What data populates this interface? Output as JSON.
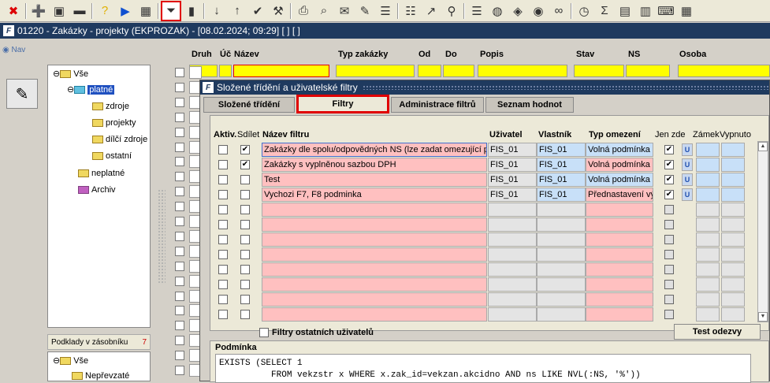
{
  "toolbar": {
    "icons": [
      "close-icon",
      "add-icon",
      "save-icon",
      "minus-icon",
      "help-icon",
      "play-icon",
      "calendar-icon",
      "filter-icon",
      "signal-icon",
      "sort-asc-icon",
      "sort-desc-icon",
      "check-icon",
      "wrench-icon",
      "print-icon",
      "print-preview-icon",
      "mail-icon",
      "edit-icon",
      "list-icon",
      "checklist-icon",
      "open-external-icon",
      "attach-icon",
      "sliders-icon",
      "globe-icon",
      "compass-icon",
      "eye-icon",
      "glasses-icon",
      "clock-icon",
      "sigma-icon",
      "excel-icon",
      "doc-icon",
      "keyboard-icon",
      "grid-icon"
    ]
  },
  "window": {
    "title": "01220 - Zakázky - projekty (EKPROZAK) - [08.02.2024; 09:29]  [ ]  [ ]"
  },
  "nav": {
    "label": "Nav"
  },
  "tree": {
    "items": [
      "Vše",
      "platné",
      "zdroje",
      "projekty",
      "dílčí zdroje",
      "ostatní",
      "neplatné",
      "Archiv"
    ]
  },
  "podklady": {
    "label": "Podklady v zásobníku",
    "count": "7"
  },
  "tree2": {
    "items": [
      "Vše",
      "Nepřevzaté"
    ]
  },
  "bg_headers": {
    "druh": "Druh",
    "uc": "Úč",
    "nazev": "Název",
    "typ": "Typ zakázky",
    "od": "Od",
    "do": "Do",
    "popis": "Popis",
    "stav": "Stav",
    "ns": "NS",
    "osoba": "Osoba"
  },
  "dialog": {
    "title": "Složené třídění a uživatelské filtry",
    "tabs": [
      "Složené třídění",
      "Filtry",
      "Administrace filtrů",
      "Seznam hodnot"
    ],
    "headers": {
      "aktiv": "Aktiv.",
      "sdilet": "Sdílet",
      "nazev": "Název filtru",
      "uzivatel": "Uživatel",
      "vlastnik": "Vlastník",
      "typ": "Typ omezení",
      "jenzde": "Jen zde",
      "zamek": "Zámek",
      "vypnuto": "Vypnuto"
    },
    "rows": [
      {
        "nazev": "Zakázky dle spolu/odpovědných NS (lze zadat omezující podm",
        "uzivatel": "FIS_01",
        "vlastnik": "FIS_01",
        "typ": "Volná podmínka",
        "sdilet": "✔",
        "jenzde": "✔",
        "u": "U"
      },
      {
        "nazev": "Zakázky s vyplněnou sazbou DPH",
        "uzivatel": "FIS_01",
        "vlastnik": "FIS_01",
        "typ": "Volná podmínka",
        "sdilet": "✔",
        "jenzde": "✔",
        "u": "U"
      },
      {
        "nazev": "Test",
        "uzivatel": "FIS_01",
        "vlastnik": "FIS_01",
        "typ": "Volná podmínka",
        "sdilet": "",
        "jenzde": "✔",
        "u": "U"
      },
      {
        "nazev": "Vychozi F7, F8 podminka",
        "uzivatel": "FIS_01",
        "vlastnik": "FIS_01",
        "typ": "Přednastavení výb",
        "sdilet": "",
        "jenzde": "✔",
        "u": "U"
      }
    ],
    "others_label": "Filtry ostatních uživatelů",
    "test_button": "Test odezvy",
    "podminka_label": "Podmínka",
    "code": "EXISTS (SELECT 1\n          FROM vekzstr x WHERE x.zak_id=vekzan.akcidno AND ns LIKE NVL(:NS, '%'))"
  }
}
